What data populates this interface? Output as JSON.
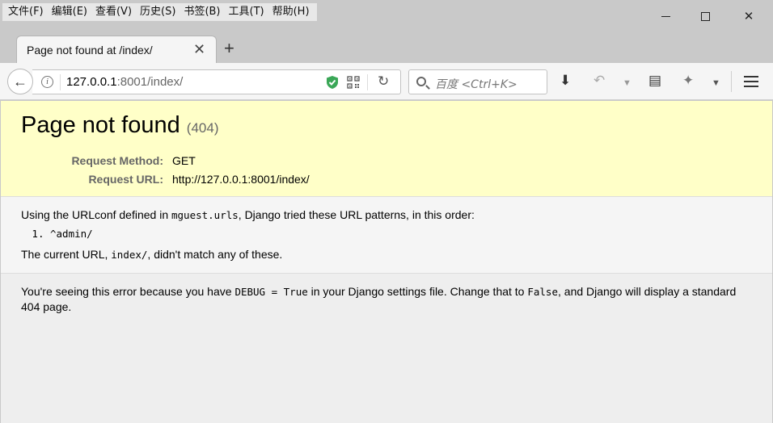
{
  "menubar": {
    "items": [
      "文件(F)",
      "编辑(E)",
      "查看(V)",
      "历史(S)",
      "书签(B)",
      "工具(T)",
      "帮助(H)"
    ]
  },
  "window_controls": {
    "minimize": "—",
    "maximize": "☐",
    "close": "✕"
  },
  "tab": {
    "title": "Page not found at /index/",
    "close": "✕",
    "new_tab": "+"
  },
  "navbar": {
    "back": "←",
    "url_host": "127.0.0.1",
    "url_rest": ":8001/index/",
    "reload": "↻",
    "search_placeholder": "百度 <Ctrl+K>",
    "icons": [
      "back-arrow-icon",
      "info-icon",
      "shield-icon",
      "qr-code-icon",
      "reload-icon",
      "search-icon",
      "download-icon",
      "undo-icon",
      "note-icon",
      "extension-icon",
      "hamburger-menu-icon"
    ]
  },
  "page": {
    "title": "Page not found",
    "code": "(404)",
    "request_method_label": "Request Method:",
    "request_method": "GET",
    "request_url_label": "Request URL:",
    "request_url": "http://127.0.0.1:8001/index/",
    "urlconf_before": "Using the URLconf defined in ",
    "urlconf_module": "mguest.urls",
    "urlconf_after": ", Django tried these URL patterns, in this order:",
    "patterns": [
      "^admin/"
    ],
    "current_before": "The current URL, ",
    "current_url": "index/",
    "current_after": ", didn't match any of these.",
    "explain_1": "You're seeing this error because you have ",
    "explain_debug": "DEBUG = True",
    "explain_2": " in your Django settings file. Change that to ",
    "explain_false": "False",
    "explain_3": ", and Django will display a standard 404 page."
  },
  "colors": {
    "summary_bg": "#ffffc8",
    "shield_green": "#3aa757"
  }
}
